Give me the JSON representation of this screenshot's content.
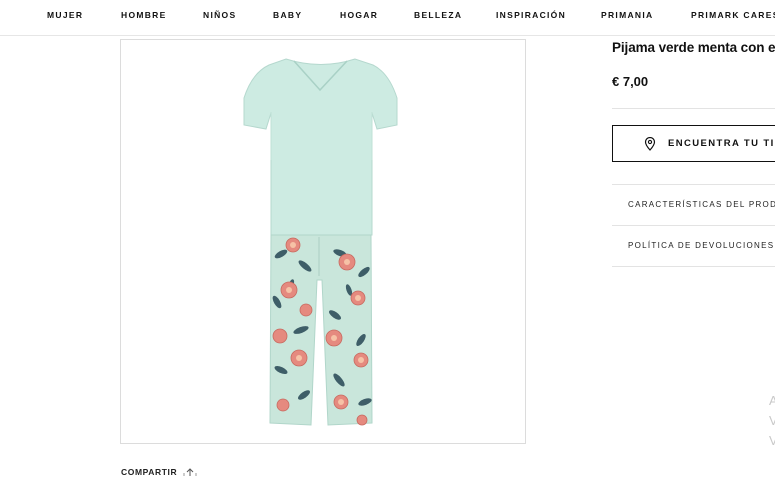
{
  "nav": {
    "items": [
      "MUJER",
      "HOMBRE",
      "NIÑOS",
      "BABY",
      "HOGAR",
      "BELLEZA",
      "INSPIRACIÓN",
      "PRIMANIA",
      "PRIMARK CARES"
    ]
  },
  "product": {
    "title": "Pijama verde menta con es",
    "price": "€ 7,00",
    "find_store_label": "ENCUENTRA TU TIEN",
    "accordion": [
      "CARACTERÍSTICAS DEL PRODUC",
      "POLÍTICA DE DEVOLUCIONES."
    ]
  },
  "share": {
    "label": "COMPARTIR"
  },
  "side_letters": [
    "A",
    "V",
    "V"
  ],
  "colors": {
    "mint": "#c9e9e0",
    "rose": "#e0837a",
    "leaf": "#3a5a63"
  }
}
